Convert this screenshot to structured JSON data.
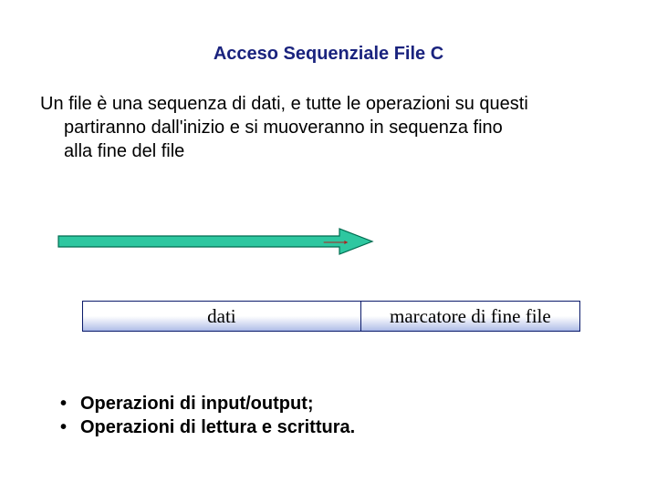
{
  "title": "Acceso Sequenziale File C",
  "paragraph_line1": "Un file è una sequenza di dati, e tutte le operazioni su questi",
  "paragraph_line2": "partiranno dall'inizio e si muoveranno in sequenza fino",
  "paragraph_line3": "alla fine del file",
  "boxes": {
    "left": "dati",
    "right": "marcatore di fine file"
  },
  "bullets": {
    "item1": "Operazioni di input/output;",
    "item2": "Operazioni di lettura e scrittura."
  },
  "colors": {
    "arrow_fill": "#2ec7a0",
    "arrow_stroke": "#006b4f",
    "small_arrow": "#b02020",
    "title_color": "#1a237e"
  }
}
